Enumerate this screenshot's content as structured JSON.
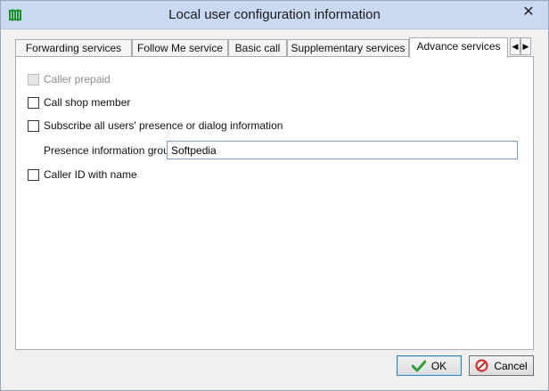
{
  "window": {
    "title": "Local user configuration information",
    "close_glyph": "✕",
    "app_icon": "green-grid-icon"
  },
  "tabs": [
    {
      "label": "Forwarding services",
      "active": false
    },
    {
      "label": "Follow Me service",
      "active": false
    },
    {
      "label": "Basic call",
      "active": false
    },
    {
      "label": "Supplementary services",
      "active": false
    },
    {
      "label": "Advance services",
      "active": true
    }
  ],
  "tab_scroll": {
    "left": "◀",
    "right": "▶"
  },
  "options": {
    "caller_prepaid": {
      "label": "Caller prepaid",
      "checked": false,
      "enabled": false
    },
    "call_shop_member": {
      "label": "Call shop member",
      "checked": false,
      "enabled": true
    },
    "subscribe_presence": {
      "label": "Subscribe all users' presence or dialog information",
      "checked": false,
      "enabled": true
    },
    "caller_id_with_name": {
      "label": "Caller ID with name",
      "checked": false,
      "enabled": true
    }
  },
  "presence_group": {
    "label": "Presence information group",
    "value": "Softpedia"
  },
  "buttons": {
    "ok": "OK",
    "cancel": "Cancel"
  },
  "colors": {
    "titlebar": "#c9d9f1",
    "ok_check": "#2e9e3a",
    "cancel_icon": "#d3302f"
  }
}
